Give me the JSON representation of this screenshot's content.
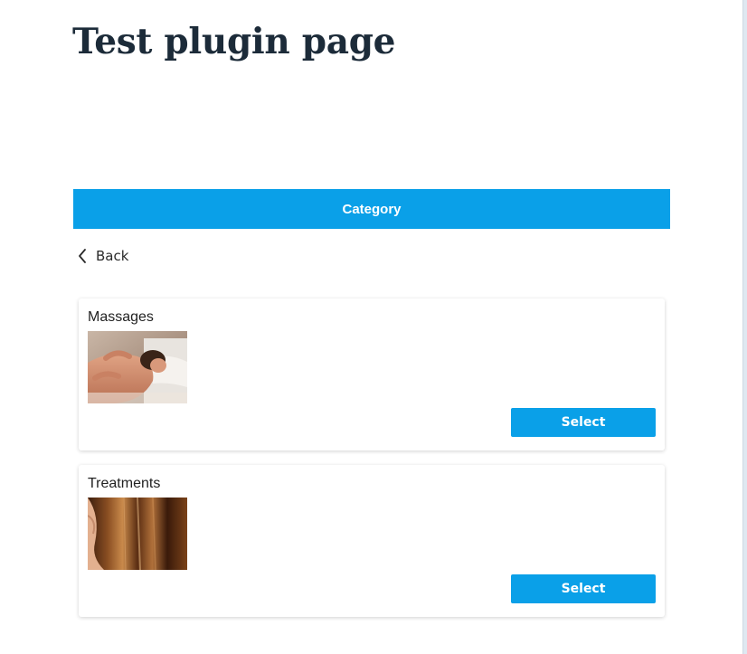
{
  "page": {
    "title": "Test plugin page"
  },
  "category_header": {
    "title": "Category",
    "color": "#0aa0e8"
  },
  "back": {
    "label": "Back",
    "icon": "chevron-left-icon"
  },
  "categories": [
    {
      "name": "Massages",
      "select_label": "Select"
    },
    {
      "name": "Treatments",
      "select_label": "Select"
    }
  ]
}
